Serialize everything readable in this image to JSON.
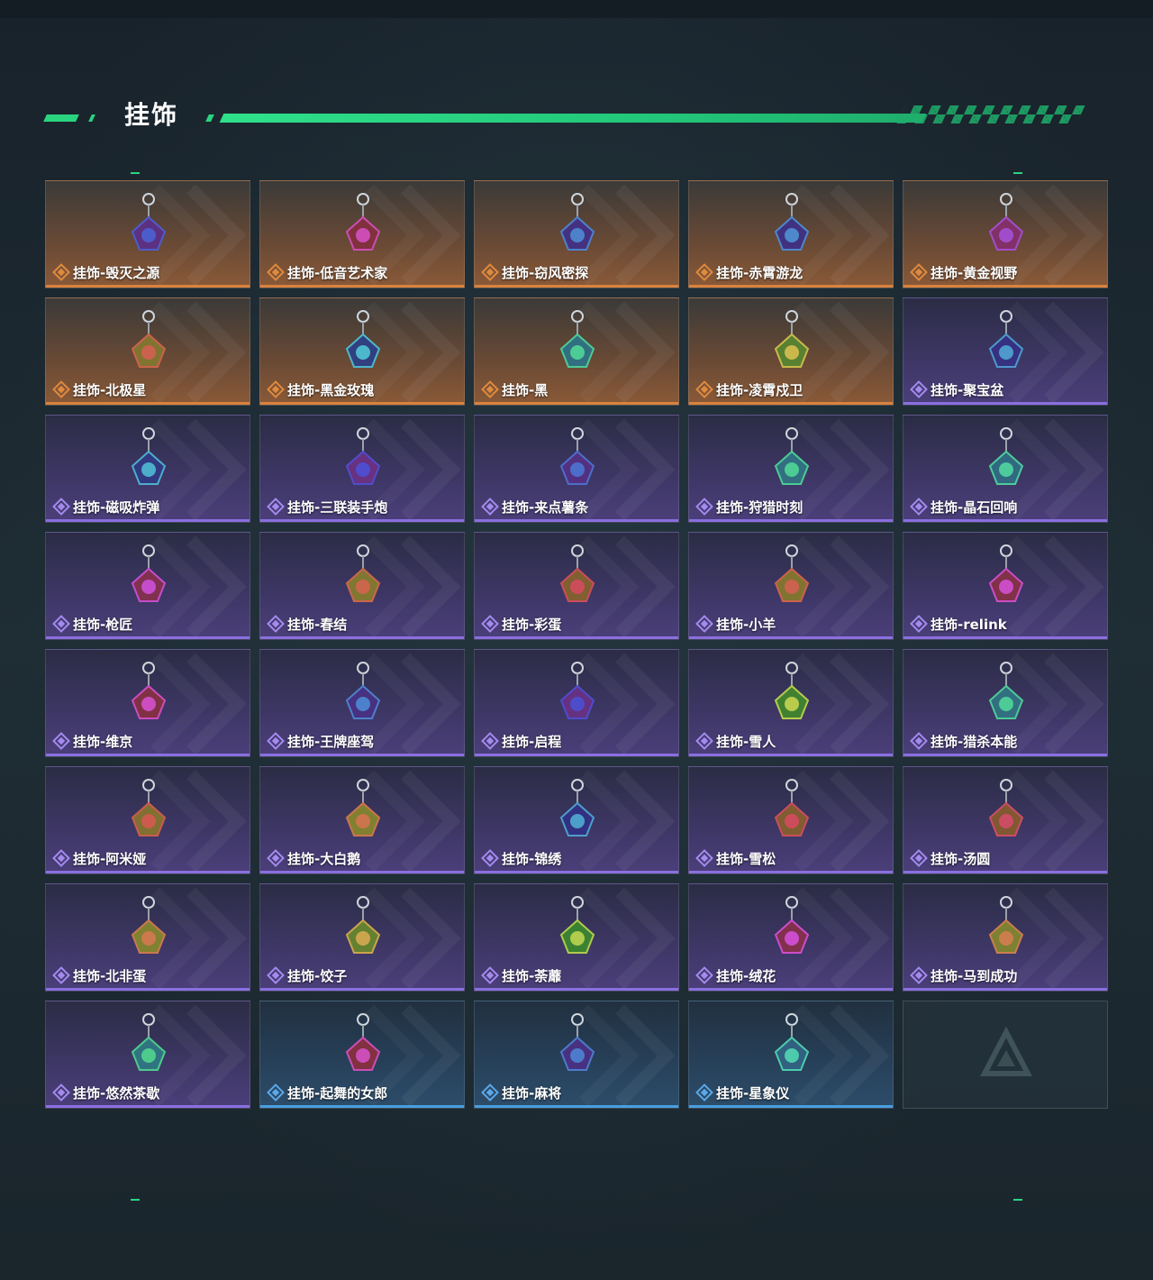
{
  "header": {
    "title": "挂饰"
  },
  "colors": {
    "accent": "#2ad47f",
    "orange": "#d9823e",
    "purple": "#8a6fe0",
    "blue": "#4a9ee0"
  },
  "items": [
    {
      "label": "挂饰-毁灭之源",
      "rarity": "orange",
      "icon": "dragon-charm-icon"
    },
    {
      "label": "挂饰-低音艺术家",
      "rarity": "orange",
      "icon": "bass-artist-charm-icon"
    },
    {
      "label": "挂饰-窃风密探",
      "rarity": "orange",
      "icon": "agent-charm-icon"
    },
    {
      "label": "挂饰-赤霄游龙",
      "rarity": "orange",
      "icon": "dragon-rider-charm-icon"
    },
    {
      "label": "挂饰-黄金视野",
      "rarity": "orange",
      "icon": "golden-vision-charm-icon"
    },
    {
      "label": "挂饰-北极星",
      "rarity": "orange",
      "icon": "star-charm-icon"
    },
    {
      "label": "挂饰-黑金玫瑰",
      "rarity": "orange",
      "icon": "rose-charm-icon"
    },
    {
      "label": "挂饰-黑",
      "rarity": "orange",
      "icon": "tag-charm-icon"
    },
    {
      "label": "挂饰-凌霄戍卫",
      "rarity": "orange",
      "icon": "guardian-charm-icon"
    },
    {
      "label": "挂饰-聚宝盆",
      "rarity": "purple",
      "icon": "treasure-bowl-charm-icon"
    },
    {
      "label": "挂饰-磁吸炸弹",
      "rarity": "purple",
      "icon": "bomb-charm-icon"
    },
    {
      "label": "挂饰-三联装手炮",
      "rarity": "purple",
      "icon": "hand-cannon-charm-icon"
    },
    {
      "label": "挂饰-来点薯条",
      "rarity": "purple",
      "icon": "fries-charm-icon"
    },
    {
      "label": "挂饰-狩猎时刻",
      "rarity": "purple",
      "icon": "antler-charm-icon"
    },
    {
      "label": "挂饰-晶石回响",
      "rarity": "purple",
      "icon": "crystal-charm-icon"
    },
    {
      "label": "挂饰-枪匠",
      "rarity": "purple",
      "icon": "gunsmith-charm-icon"
    },
    {
      "label": "挂饰-春结",
      "rarity": "purple",
      "icon": "knot-charm-icon"
    },
    {
      "label": "挂饰-彩蛋",
      "rarity": "purple",
      "icon": "easter-egg-charm-icon"
    },
    {
      "label": "挂饰-小羊",
      "rarity": "purple",
      "icon": "lamb-charm-icon"
    },
    {
      "label": "挂饰-relink",
      "rarity": "purple",
      "icon": "relink-charm-icon"
    },
    {
      "label": "挂饰-维京",
      "rarity": "purple",
      "icon": "viking-charm-icon"
    },
    {
      "label": "挂饰-王牌座驾",
      "rarity": "purple",
      "icon": "plane-charm-icon"
    },
    {
      "label": "挂饰-启程",
      "rarity": "purple",
      "icon": "departure-charm-icon"
    },
    {
      "label": "挂饰-雪人",
      "rarity": "purple",
      "icon": "snowman-charm-icon"
    },
    {
      "label": "挂饰-猎杀本能",
      "rarity": "purple",
      "icon": "antler-charm-icon"
    },
    {
      "label": "挂饰-阿米娅",
      "rarity": "purple",
      "icon": "amiya-charm-icon"
    },
    {
      "label": "挂饰-大白鹅",
      "rarity": "purple",
      "icon": "goose-charm-icon"
    },
    {
      "label": "挂饰-锦绣",
      "rarity": "purple",
      "icon": "butterfly-charm-icon"
    },
    {
      "label": "挂饰-雪松",
      "rarity": "purple",
      "icon": "pine-tree-charm-icon"
    },
    {
      "label": "挂饰-汤圆",
      "rarity": "purple",
      "icon": "tangyuan-charm-icon"
    },
    {
      "label": "挂饰-北非蛋",
      "rarity": "purple",
      "icon": "shakshuka-charm-icon"
    },
    {
      "label": "挂饰-饺子",
      "rarity": "purple",
      "icon": "dumpling-charm-icon"
    },
    {
      "label": "挂饰-荼蘼",
      "rarity": "purple",
      "icon": "flower-charm-icon"
    },
    {
      "label": "挂饰-绒花",
      "rarity": "purple",
      "icon": "velvet-flower-charm-icon"
    },
    {
      "label": "挂饰-马到成功",
      "rarity": "purple",
      "icon": "horse-charm-icon"
    },
    {
      "label": "挂饰-悠然茶歇",
      "rarity": "purple",
      "icon": "cupcake-charm-icon"
    },
    {
      "label": "挂饰-起舞的女郎",
      "rarity": "blue",
      "icon": "dancer-charm-icon"
    },
    {
      "label": "挂饰-麻将",
      "rarity": "blue",
      "icon": "mahjong-charm-icon"
    },
    {
      "label": "挂饰-星象仪",
      "rarity": "blue",
      "icon": "astrolabe-charm-icon"
    }
  ]
}
